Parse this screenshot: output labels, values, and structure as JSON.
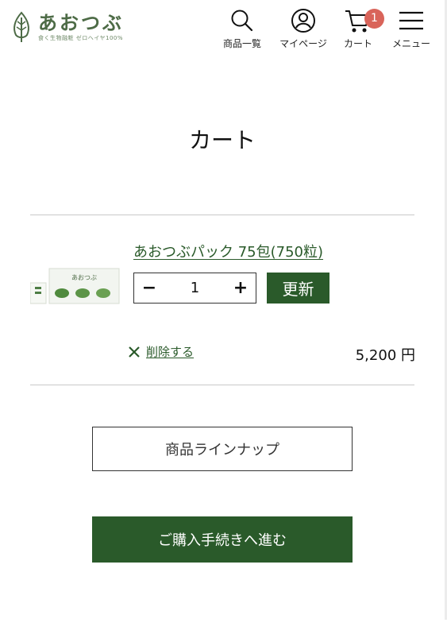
{
  "header": {
    "logo_title": "あおつぶ",
    "logo_subtitle": "食く生物融粧 ゼロヘイヤ100%",
    "nav": {
      "products": "商品一覧",
      "mypage": "マイページ",
      "cart": "カート",
      "menu": "メニュー"
    },
    "cart_count": "1"
  },
  "page_title": "カート",
  "cart_item": {
    "name": "あおつぶパック 75包(750粒)",
    "quantity": "1",
    "minus_label": "−",
    "plus_label": "+",
    "update_label": "更新",
    "remove_label": "削除する",
    "price": "5,200 円",
    "thumbnail_text": "あおつぶ"
  },
  "buttons": {
    "lineup": "商品ラインナップ",
    "checkout": "ご購入手続きへ進む"
  },
  "colors": {
    "brand_green": "#2a5a2a",
    "logo_green": "#4d6b46",
    "badge_red": "#d9645a"
  }
}
